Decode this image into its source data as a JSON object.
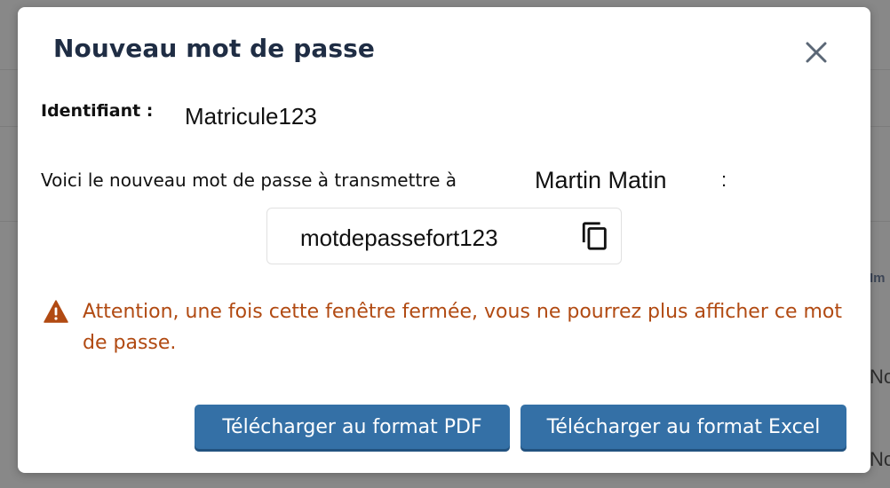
{
  "dialog": {
    "title": "Nouveau mot de passe",
    "identifier_label": "Identifiant :",
    "identifier_value": "Matricule123",
    "message": "Voici le nouveau mot de passe à transmettre à",
    "recipient": "Martin Matin",
    "colon": ":",
    "password": "motdepassefort123",
    "warning": "Attention, une fois cette fenêtre fermée, vous ne pourrez plus afficher ce mot de passe.",
    "buttons": {
      "pdf": "Télécharger au format PDF",
      "excel": "Télécharger au format Excel"
    },
    "icons": {
      "close": "close-icon",
      "copy": "copy-icon",
      "warning": "warning-icon"
    }
  },
  "background": {
    "column_header": "Im",
    "row_1": "No",
    "row_2": "No"
  },
  "colors": {
    "primary_button": "#3470a6",
    "warning_text": "#b14a12",
    "title_text": "#1f2d44",
    "overlay": "#888888"
  }
}
